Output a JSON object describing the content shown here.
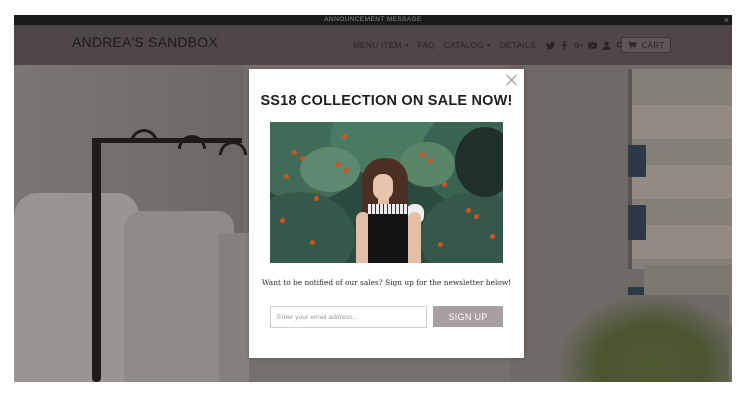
{
  "announcement": {
    "text": "ANNOUNCEMENT MESSAGE",
    "close_glyph": "×"
  },
  "header": {
    "logo": "ANDREA'S SANDBOX",
    "nav": [
      {
        "label": "MENU ITEM",
        "has_dropdown": true
      },
      {
        "label": "FAQ",
        "has_dropdown": false
      },
      {
        "label": "CATALOG",
        "has_dropdown": true
      },
      {
        "label": "DETAILS",
        "has_dropdown": false
      }
    ],
    "social_icons": [
      "twitter-icon",
      "facebook-icon",
      "google-plus-icon",
      "youtube-icon"
    ],
    "utility_icons": [
      "account-icon",
      "search-icon"
    ],
    "cart_label": "CART"
  },
  "popup": {
    "title": "SS18 COLLECTION ON SALE NOW!",
    "image_alt": "Woman with curly hair in front of a rowan tree with red berries",
    "description": "Want to be notified of our sales? Sign up for the newsletter below!",
    "email_placeholder": "Enter your email address...",
    "email_value": "",
    "signup_label": "SIGN UP"
  },
  "colors": {
    "announcement_bg": "#1a1a1a",
    "header_overlay": "#4e4648",
    "signup_button": "#a99ea4",
    "modal_bg": "#ffffff"
  }
}
